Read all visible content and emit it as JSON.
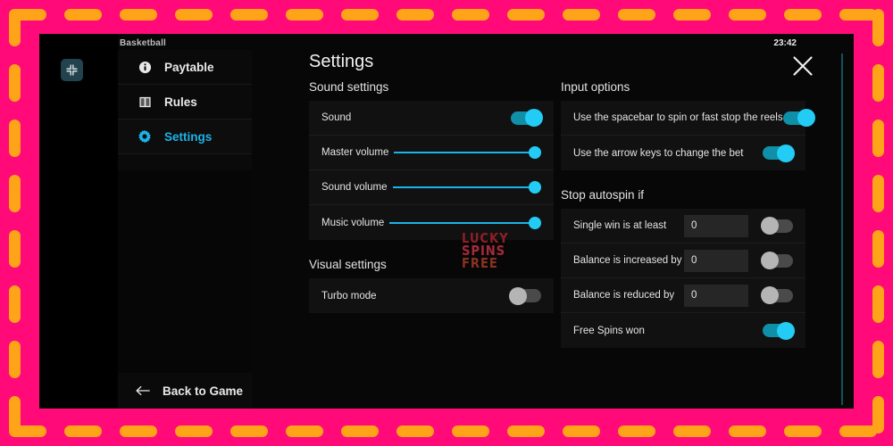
{
  "window": {
    "game_title": "Basketball",
    "clock": "23:42",
    "fullscreen_icon": "compress-arrows-icon"
  },
  "watermark": {
    "line1": "LUCKY",
    "line2": "SPINS",
    "line3": "FREE"
  },
  "sidebar": {
    "items": [
      {
        "label": "Paytable",
        "icon": "info-circle-icon",
        "active": false
      },
      {
        "label": "Rules",
        "icon": "book-icon",
        "active": false
      },
      {
        "label": "Settings",
        "icon": "gear-icon",
        "active": true
      }
    ],
    "back": {
      "label": "Back to Game",
      "icon": "arrow-left-icon"
    }
  },
  "header": {
    "title": "Settings",
    "close_icon": "close-icon"
  },
  "sections": {
    "sound": {
      "title": "Sound settings",
      "rows": [
        {
          "label": "Sound",
          "control": "toggle",
          "state": "on"
        },
        {
          "label": "Master volume",
          "control": "slider",
          "value": 100
        },
        {
          "label": "Sound volume",
          "control": "slider",
          "value": 100
        },
        {
          "label": "Music volume",
          "control": "slider",
          "value": 100
        }
      ]
    },
    "visual": {
      "title": "Visual settings",
      "rows": [
        {
          "label": "Turbo mode",
          "control": "toggle",
          "state": "off"
        }
      ]
    },
    "input": {
      "title": "Input options",
      "rows": [
        {
          "label": "Use the spacebar to spin or fast stop the reels",
          "control": "toggle",
          "state": "on"
        },
        {
          "label": "Use the arrow keys to change the bet",
          "control": "toggle",
          "state": "on"
        }
      ]
    },
    "autospin": {
      "title": "Stop autospin if",
      "rows": [
        {
          "label": "Single win is at least",
          "control": "input-toggle",
          "value": "0",
          "state": "off"
        },
        {
          "label": "Balance is increased by",
          "control": "input-toggle",
          "value": "0",
          "state": "off"
        },
        {
          "label": "Balance is reduced by",
          "control": "input-toggle",
          "value": "0",
          "state": "off"
        },
        {
          "label": "Free Spins won",
          "control": "toggle",
          "state": "on"
        }
      ]
    }
  },
  "colors": {
    "frame_pink": "#FF0A78",
    "dash_orange": "#FFA418",
    "accent_cyan": "#1BB4E8",
    "toggle_on": "#108fa8",
    "toggle_off": "#4a4a4a"
  }
}
